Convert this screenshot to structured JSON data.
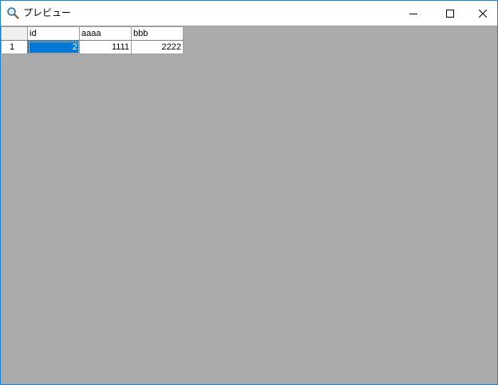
{
  "window": {
    "title": "プレビュー",
    "icon": "magnifier-icon",
    "controls": {
      "minimize_icon": "minimize-icon",
      "maximize_icon": "maximize-icon",
      "close_icon": "close-icon"
    }
  },
  "grid": {
    "columns": [
      "id",
      "aaaa",
      "bbb"
    ],
    "rows": [
      {
        "row_number": "1",
        "cells": [
          "2",
          "1111",
          "2222"
        ]
      }
    ],
    "selected_cell": {
      "row": 0,
      "col": 0
    }
  },
  "colors": {
    "background": "#ababab",
    "selection": "#0078d7",
    "window_border": "#1883d7"
  }
}
